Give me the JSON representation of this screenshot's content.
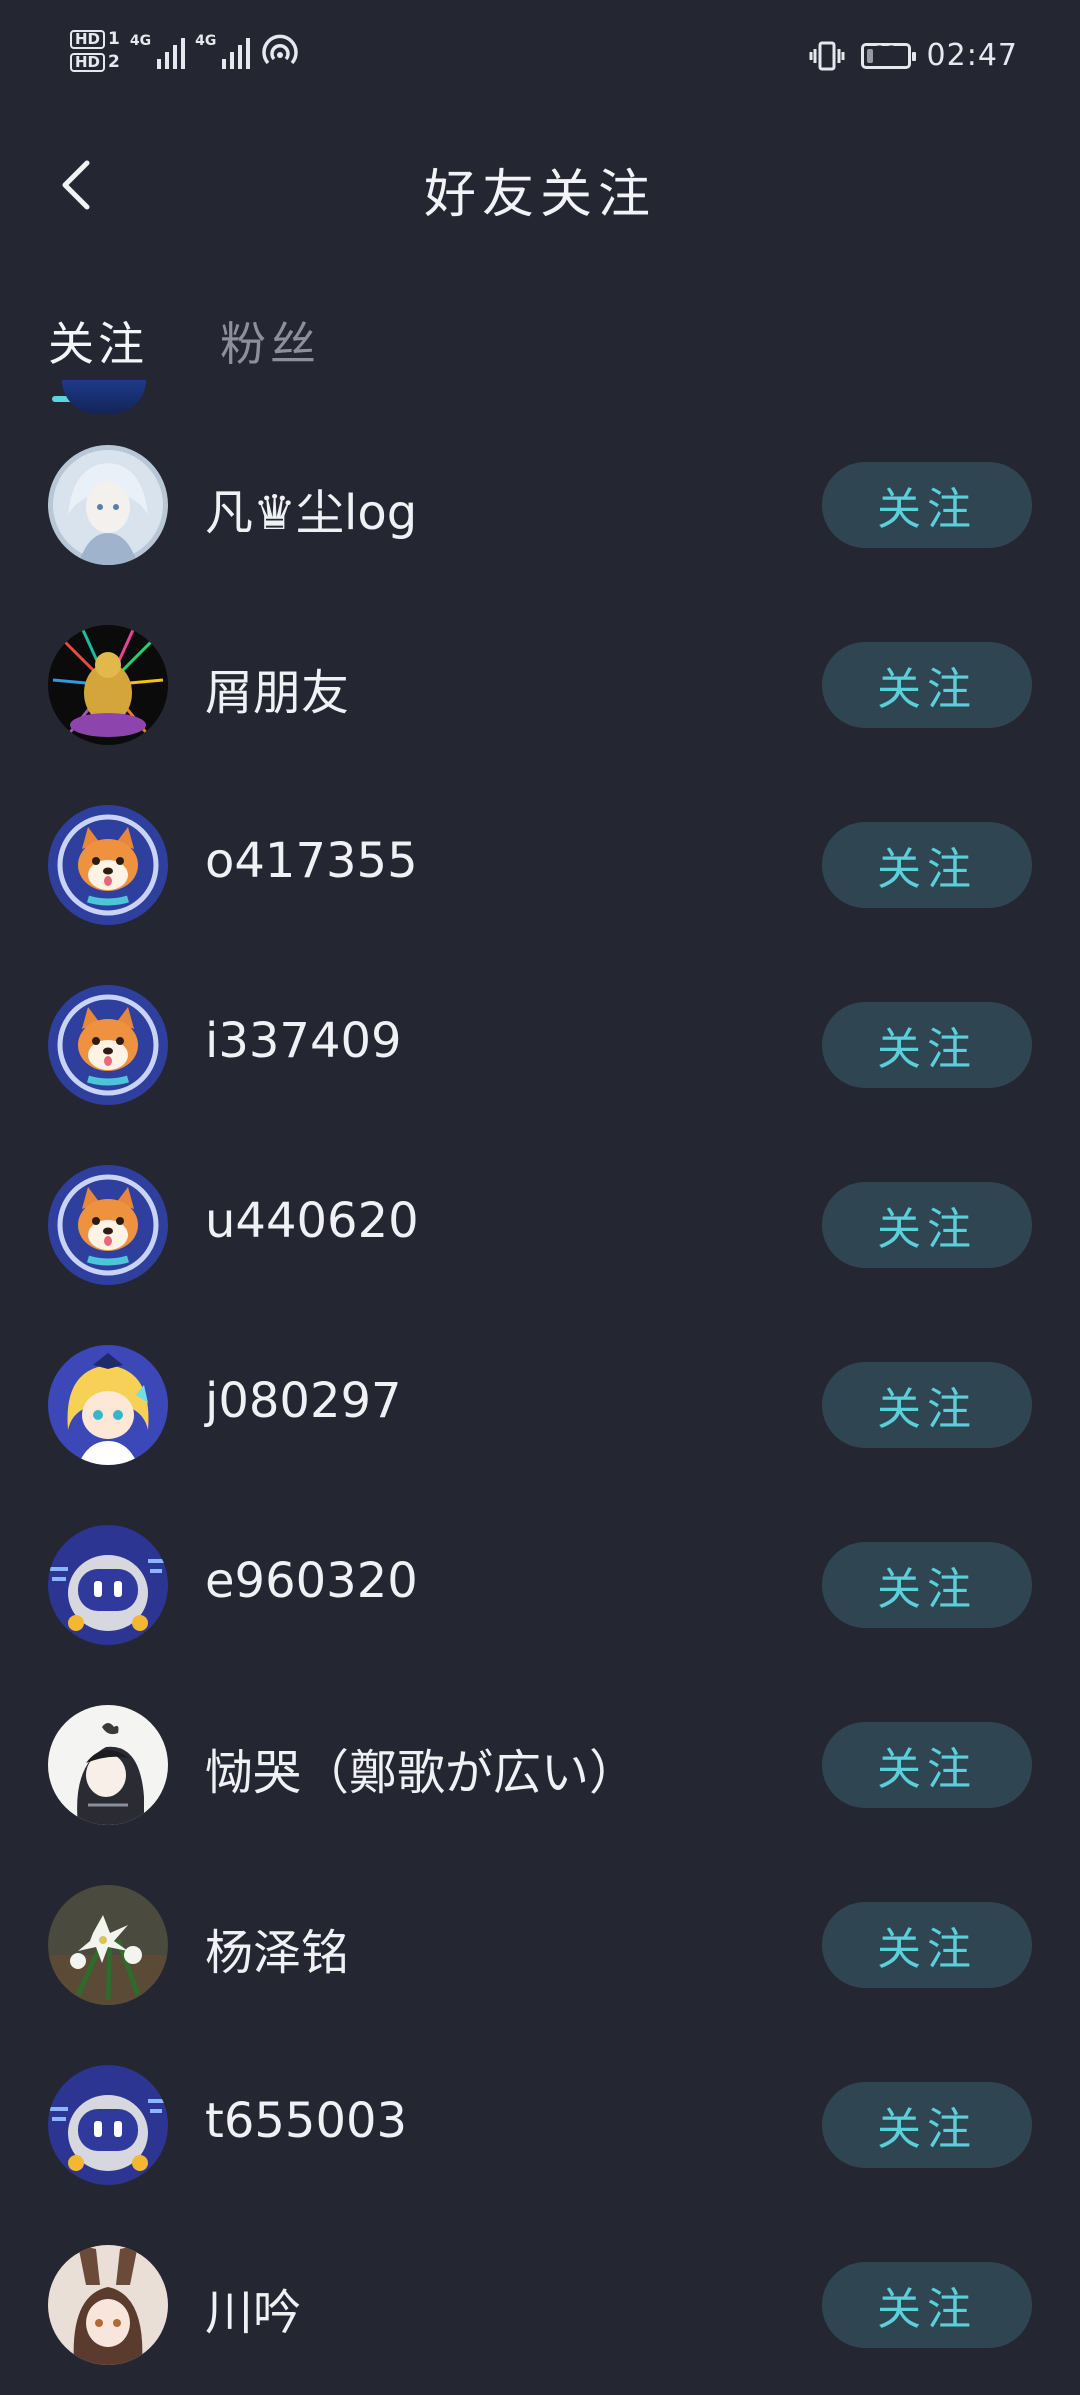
{
  "status_bar": {
    "hd1": "HD",
    "hd1_index": "1",
    "hd2": "HD",
    "hd2_index": "2",
    "net1": "4G",
    "net2": "4G",
    "battery_level": "11",
    "time": "02:47"
  },
  "header": {
    "title": "好友关注"
  },
  "tabs": [
    {
      "label": "关注",
      "active": true
    },
    {
      "label": "粉丝",
      "active": false
    }
  ],
  "follow_label": "关注",
  "users": [
    {
      "name": "凡♛尘log",
      "avatar": "anime-girl-blue"
    },
    {
      "name": "屑朋友",
      "avatar": "golden-buddha"
    },
    {
      "name": "o417355",
      "avatar": "shiba-dog"
    },
    {
      "name": "i337409",
      "avatar": "shiba-dog"
    },
    {
      "name": "u440620",
      "avatar": "shiba-dog"
    },
    {
      "name": "j080297",
      "avatar": "anime-blonde-girl"
    },
    {
      "name": "e960320",
      "avatar": "robot"
    },
    {
      "name": "恸哭（鄭歌が広い）",
      "avatar": "anime-dark-hair-girl"
    },
    {
      "name": "杨泽铭",
      "avatar": "white-flowers"
    },
    {
      "name": "t655003",
      "avatar": "robot"
    },
    {
      "name": "川吟",
      "avatar": "anime-bunny-girl"
    }
  ],
  "colors": {
    "background": "#242631",
    "accent": "#58d7df",
    "button_bg": "#2f4652",
    "button_text": "#5cd0da",
    "inactive_tab": "#8d909c"
  }
}
